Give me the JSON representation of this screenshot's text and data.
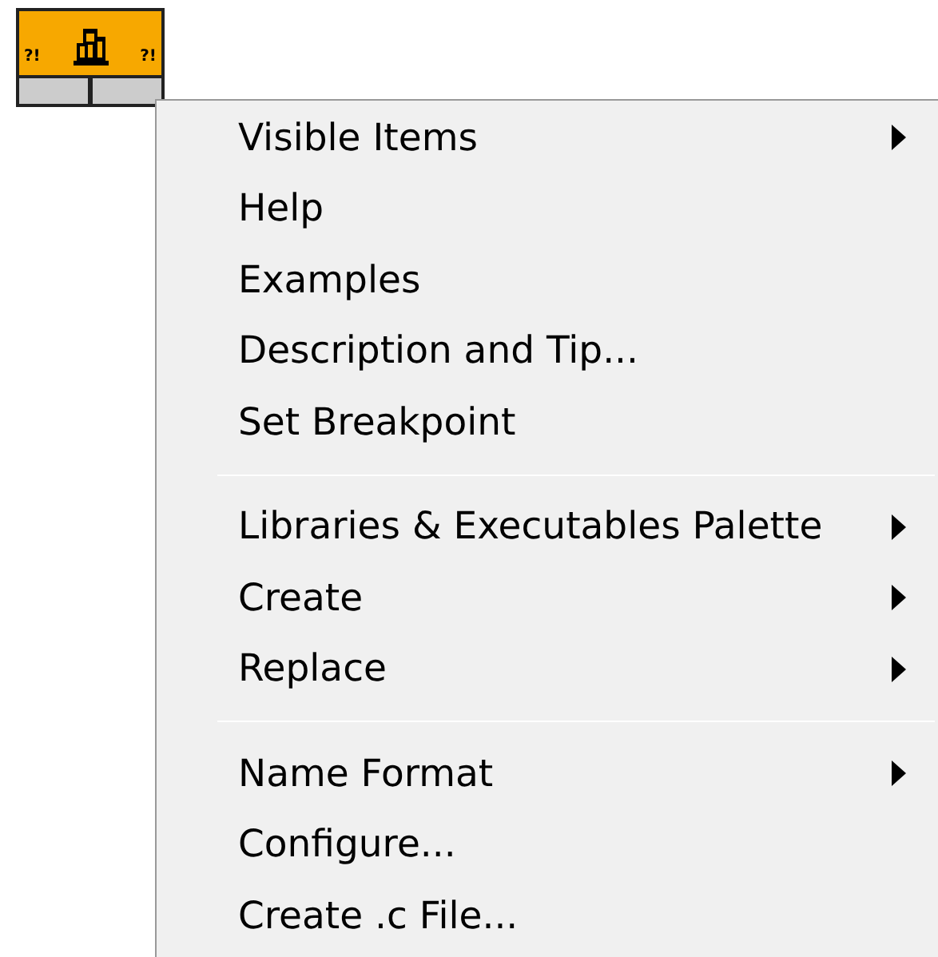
{
  "node": {
    "left_mark": "?!",
    "right_mark": "?!"
  },
  "menu": {
    "groups": [
      [
        {
          "label": "Visible Items",
          "submenu": true
        },
        {
          "label": "Help",
          "submenu": false
        },
        {
          "label": "Examples",
          "submenu": false
        },
        {
          "label": "Description and Tip...",
          "submenu": false
        },
        {
          "label": "Set Breakpoint",
          "submenu": false
        }
      ],
      [
        {
          "label": "Libraries & Executables Palette",
          "submenu": true
        },
        {
          "label": "Create",
          "submenu": true
        },
        {
          "label": "Replace",
          "submenu": true
        }
      ],
      [
        {
          "label": "Name Format",
          "submenu": true
        },
        {
          "label": "Configure...",
          "submenu": false
        },
        {
          "label": "Create .c File...",
          "submenu": false
        }
      ]
    ]
  }
}
